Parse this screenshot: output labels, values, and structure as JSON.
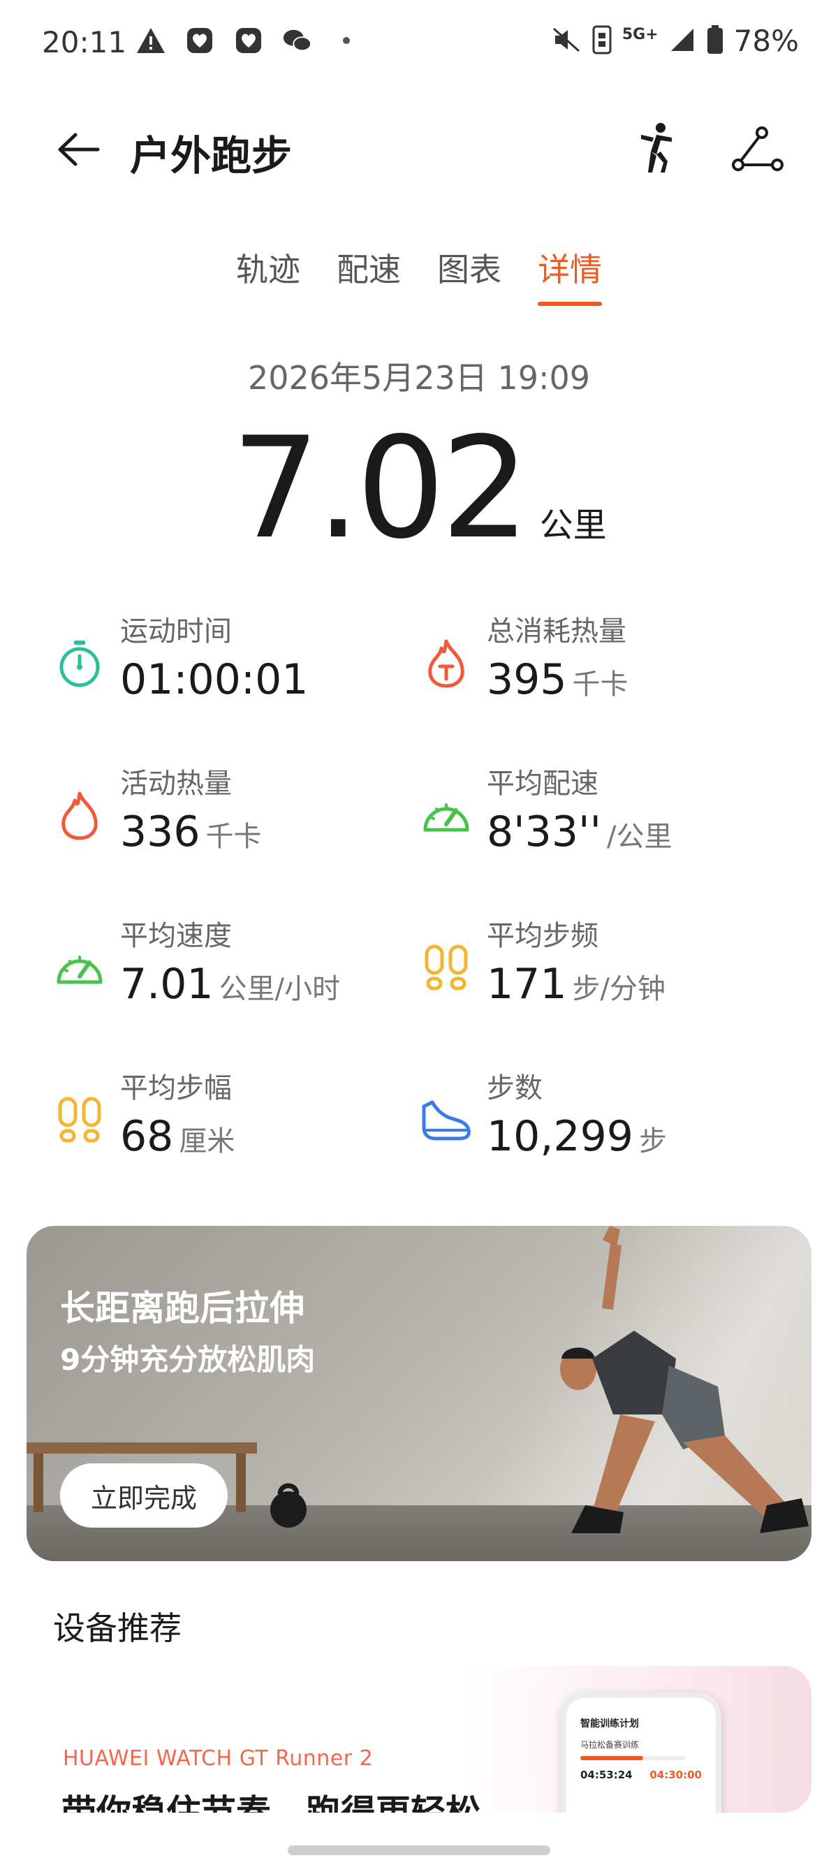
{
  "status_bar": {
    "time": "20:11",
    "network": "5G+",
    "battery": "78%"
  },
  "header": {
    "title": "户外跑步"
  },
  "tabs": [
    {
      "label": "轨迹"
    },
    {
      "label": "配速"
    },
    {
      "label": "图表"
    },
    {
      "label": "详情"
    }
  ],
  "active_tab": "详情",
  "summary": {
    "date": "2026年5月23日 19:09",
    "distance": "7.02",
    "distance_unit": "公里"
  },
  "metrics": [
    {
      "label": "运动时间",
      "value": "01:00:01",
      "unit": "",
      "icon": "stopwatch-icon",
      "color": "#2bbf9a"
    },
    {
      "label": "总消耗热量",
      "value": "395",
      "unit": "千卡",
      "icon": "flame-total-icon",
      "color": "#ef5a3a"
    },
    {
      "label": "活动热量",
      "value": "336",
      "unit": "千卡",
      "icon": "flame-icon",
      "color": "#ef5a3a"
    },
    {
      "label": "平均配速",
      "value": "8'33''",
      "unit": "/公里",
      "icon": "pace-gauge-icon",
      "color": "#47c24a"
    },
    {
      "label": "平均速度",
      "value": "7.01",
      "unit": "公里/小时",
      "icon": "speed-gauge-icon",
      "color": "#47c24a"
    },
    {
      "label": "平均步频",
      "value": "171",
      "unit": "步/分钟",
      "icon": "footprints-icon",
      "color": "#f2b632"
    },
    {
      "label": "平均步幅",
      "value": "68",
      "unit": "厘米",
      "icon": "footprints-stride-icon",
      "color": "#f2b632"
    },
    {
      "label": "步数",
      "value": "10,299",
      "unit": "步",
      "icon": "shoe-icon",
      "color": "#3b7be8"
    }
  ],
  "banner": {
    "title": "长距离跑后拉伸",
    "subtitle": "9分钟充分放松肌肉",
    "button": "立即完成"
  },
  "device_section": {
    "title": "设备推荐",
    "brand": "HUAWEI WATCH GT Runner 2",
    "tagline": "带你稳住节奏，跑得更轻松",
    "phone_title": "智能训练计划",
    "phone_subtitle": "马拉松备赛训练",
    "phone_time_left": "04:53:24",
    "phone_time_right": "04:30:00"
  },
  "colors": {
    "accent": "#f05a1f",
    "text": "#1a1a1a",
    "muted": "#666666"
  }
}
